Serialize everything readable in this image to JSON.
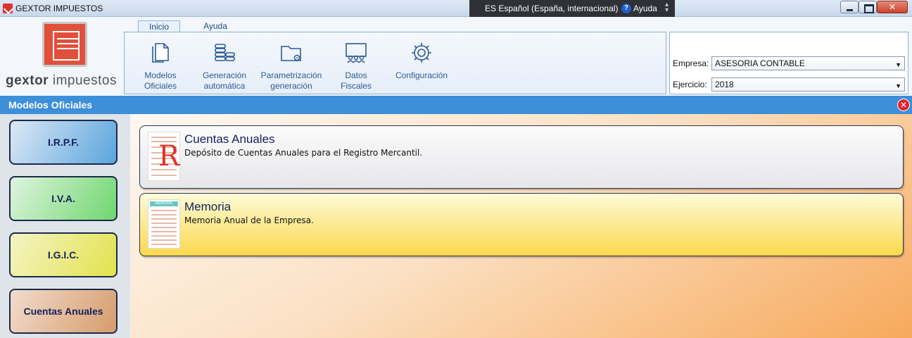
{
  "window": {
    "title": "GEXTOR IMPUESTOS"
  },
  "language_bar": {
    "language": "ES Español (España, internacional)",
    "help": "Ayuda"
  },
  "logo": {
    "text_bold": "gextor",
    "text_light": " impuestos"
  },
  "ribbon": {
    "tabs": [
      {
        "label": "Inicio",
        "active": true
      },
      {
        "label": "Ayuda",
        "active": false
      }
    ],
    "buttons": [
      {
        "label_line1": "Modelos",
        "label_line2": "Oficiales",
        "icon": "documents-icon"
      },
      {
        "label_line1": "Generación",
        "label_line2": "automática",
        "icon": "coins-stack-icon"
      },
      {
        "label_line1": "Parametrización",
        "label_line2": "generación",
        "icon": "folder-gear-icon"
      },
      {
        "label_line1": "Datos Fiscales",
        "label_line2": "",
        "icon": "audience-icon"
      },
      {
        "label_line1": "Configuración",
        "label_line2": "",
        "icon": "gear-icon"
      }
    ]
  },
  "company_panel": {
    "empresa_label": "Empresa:",
    "empresa_value": "ASESORIA CONTABLE",
    "ejercicio_label": "Ejercicio:",
    "ejercicio_value": "2018"
  },
  "section": {
    "title": "Modelos Oficiales"
  },
  "left_nav": [
    {
      "label": "I.R.P.F.",
      "color": "#5aa4dc"
    },
    {
      "label": "I.V.A.",
      "color": "#6fd66f"
    },
    {
      "label": "I.G.I.C.",
      "color": "#e2e24e"
    },
    {
      "label": "Cuentas Anuales",
      "color": "#d69c6c"
    }
  ],
  "cards": [
    {
      "title": "Cuentas Anuales",
      "description": "Depósito de Cuentas Anuales para el Registro Mercantil."
    },
    {
      "title": "Memoria",
      "description": "Memoria Anual de la Empresa.",
      "thumb_label": "MEMORIA"
    }
  ],
  "colors": {
    "section_header": "#3c8fd8",
    "accent_red": "#e3242b",
    "nav_text": "#13215a"
  }
}
